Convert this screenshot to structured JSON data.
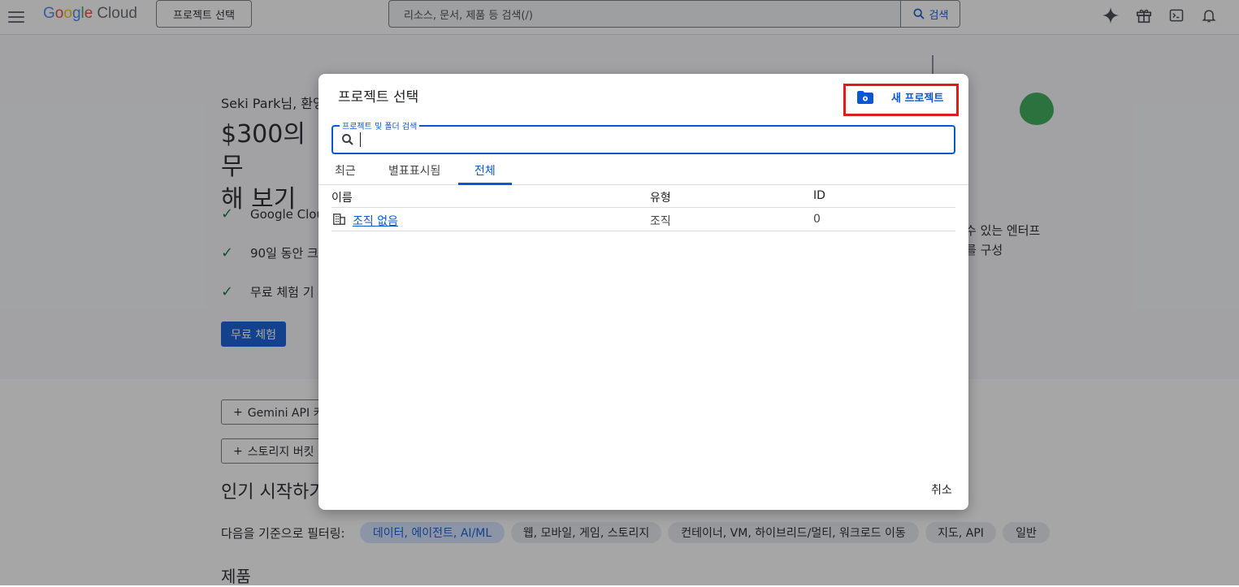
{
  "topbar": {
    "logo_letters": [
      "G",
      "o",
      "o",
      "g",
      "l",
      "e"
    ],
    "logo_product": "Cloud",
    "project_button": "프로젝트 선택",
    "search_placeholder": "리소스, 문서, 제품 등 검색(/)",
    "search_button": "검색",
    "icons": [
      "menu-icon",
      "gemini-sparkle-icon",
      "gift-icon",
      "terminal-icon",
      "bell-icon"
    ]
  },
  "background": {
    "greeting": "Seki Park님, 환영",
    "title_line1": "$300의 무",
    "title_line2": "해 보기",
    "checks": [
      "Google Clou",
      "90일 동안 크",
      "무료 체험 기"
    ],
    "trial_button": "무료 체험",
    "right_text_line1": "수 있는 엔터프",
    "right_text_line2": "를 구성",
    "gemini_button": "Gemini API 키",
    "storage_button": "스토리지 버킷",
    "popular_title": "인기 시작하기",
    "filter_label": "다음을 기준으로 필터링:",
    "chips": [
      "데이터, 에이전트, AI/ML",
      "웹, 모바일, 게임, 스토리지",
      "컨테이너, VM, 하이브리드/멀티, 워크로드 이동",
      "지도, API",
      "일반"
    ],
    "products_title": "제품"
  },
  "dialog": {
    "title": "프로젝트 선택",
    "new_project": "새 프로젝트",
    "search_label": "프로젝트 및 폴더 검색",
    "search_value": "",
    "tabs": [
      "최근",
      "별표표시됨",
      "전체"
    ],
    "active_tab": "전체",
    "columns": [
      "이름",
      "유형",
      "ID"
    ],
    "rows": [
      {
        "name": "조직 없음",
        "type": "조직",
        "id": "0"
      }
    ],
    "cancel": "취소"
  },
  "colors": {
    "accent": "#0b57d0",
    "highlight_box": "#e01b1b",
    "check": "#137333"
  }
}
